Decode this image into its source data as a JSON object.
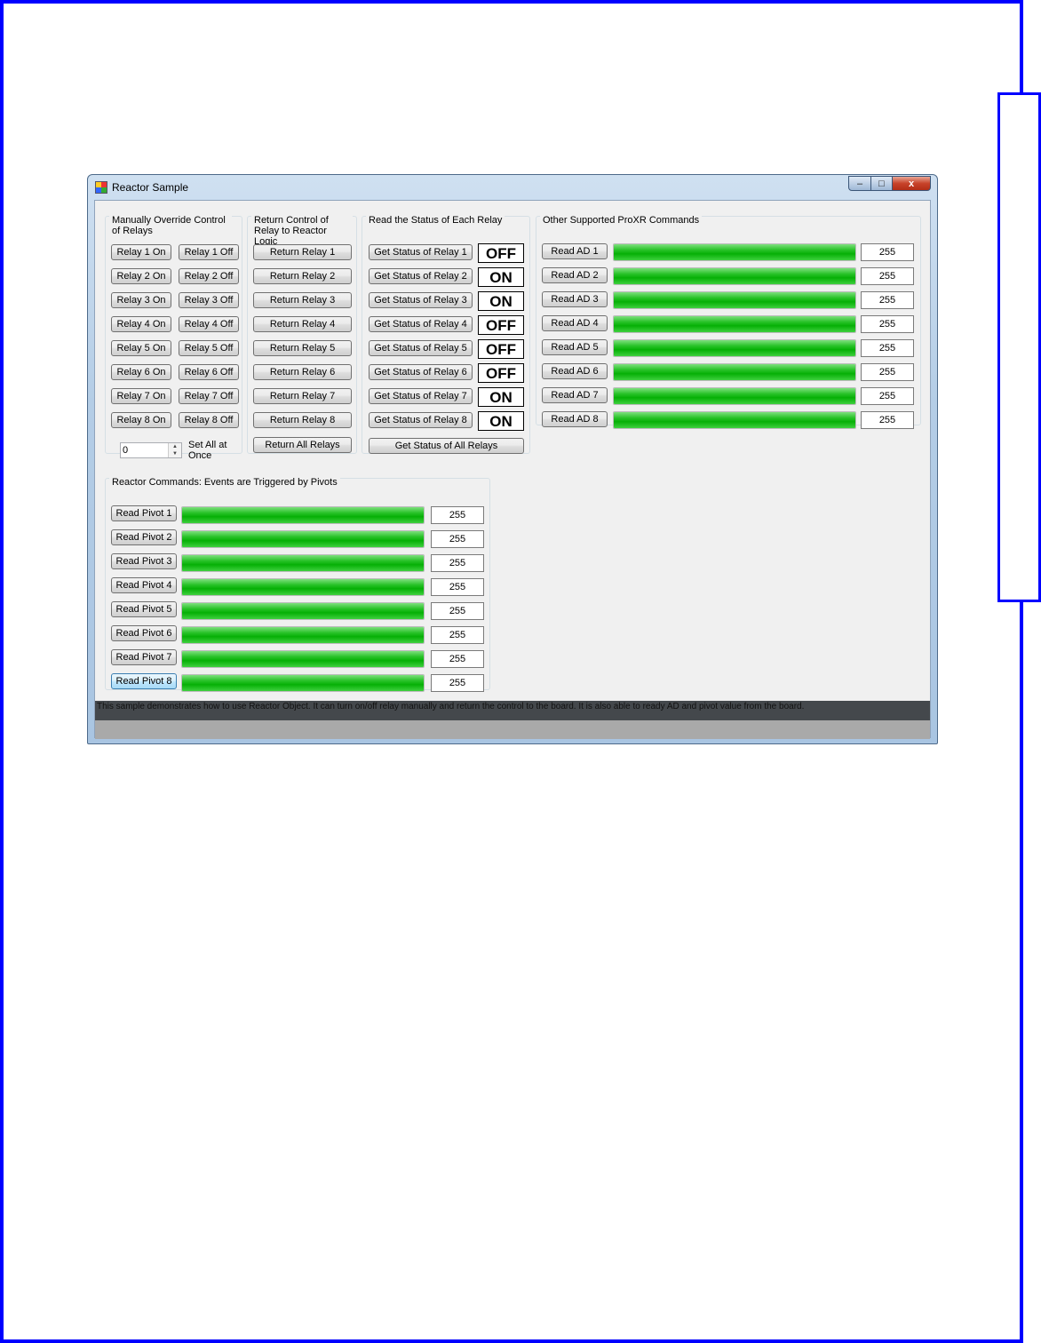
{
  "window": {
    "title": "Reactor Sample",
    "controls": {
      "minimize": "‒",
      "maximize": "□",
      "close": "x"
    }
  },
  "manual_override": {
    "title": "Manually Override Control of Relays",
    "on_buttons": [
      "Relay 1 On",
      "Relay 2 On",
      "Relay 3 On",
      "Relay 4 On",
      "Relay 5 On",
      "Relay 6 On",
      "Relay 7 On",
      "Relay 8 On"
    ],
    "off_buttons": [
      "Relay 1 Off",
      "Relay 2 Off",
      "Relay 3 Off",
      "Relay 4 Off",
      "Relay 5 Off",
      "Relay 6 Off",
      "Relay 7 Off",
      "Relay 8 Off"
    ],
    "set_all_value": "0",
    "set_all_label": "Set All at Once"
  },
  "return_control": {
    "title": "Return Control of Relay to Reactor Logic",
    "buttons": [
      "Return Relay 1",
      "Return Relay 2",
      "Return Relay 3",
      "Return Relay 4",
      "Return Relay 5",
      "Return Relay 6",
      "Return Relay 7",
      "Return Relay 8"
    ],
    "all_button": "Return All Relays"
  },
  "relay_status": {
    "title": "Read the Status of Each Relay",
    "buttons": [
      "Get Status of Relay 1",
      "Get Status of Relay 2",
      "Get Status of Relay 3",
      "Get Status of Relay 4",
      "Get Status of Relay 5",
      "Get Status of Relay 6",
      "Get Status of Relay 7",
      "Get Status of Relay 8"
    ],
    "states": [
      "OFF",
      "ON",
      "ON",
      "OFF",
      "OFF",
      "OFF",
      "ON",
      "ON"
    ],
    "all_button": "Get Status of All Relays"
  },
  "proxr": {
    "title": "Other Supported ProXR Commands",
    "buttons": [
      "Read AD 1",
      "Read AD 2",
      "Read AD 3",
      "Read AD 4",
      "Read AD 5",
      "Read AD 6",
      "Read AD 7",
      "Read AD 8"
    ],
    "values": [
      "255",
      "255",
      "255",
      "255",
      "255",
      "255",
      "255",
      "255"
    ],
    "fill_fraction": 1.0
  },
  "pivots": {
    "title": "Reactor Commands:  Events are Triggered by Pivots",
    "buttons": [
      "Read Pivot 1",
      "Read Pivot 2",
      "Read Pivot 3",
      "Read Pivot 4",
      "Read Pivot 5",
      "Read Pivot 6",
      "Read Pivot 7",
      "Read Pivot 8"
    ],
    "values": [
      "255",
      "255",
      "255",
      "255",
      "255",
      "255",
      "255",
      "255"
    ],
    "fill_fraction": 1.0
  },
  "status_bar": {
    "text": "This sample demonstrates how to use Reactor Object. It can turn on/off relay manually and return the control to the board. It is also able to ready AD and pivot value from the board."
  },
  "colors": {
    "page_border": "#0000ff",
    "progress_green": "#06b006"
  }
}
